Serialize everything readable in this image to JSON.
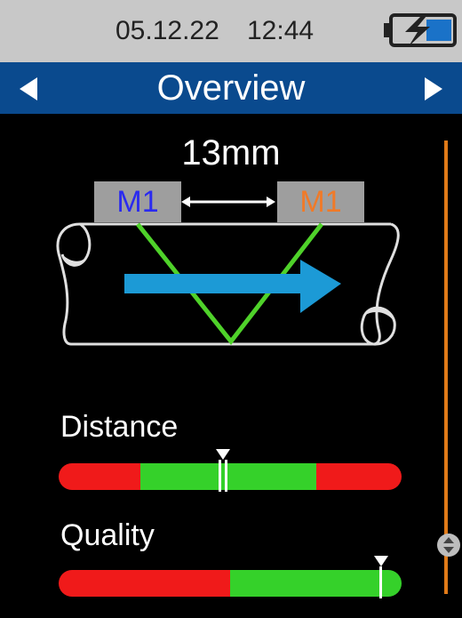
{
  "status": {
    "date": "05.12.22",
    "time": "12:44",
    "battery_icon": "battery-charging-icon"
  },
  "header": {
    "title": "Overview",
    "prev_icon": "left-arrow-icon",
    "next_icon": "right-arrow-icon"
  },
  "setup": {
    "sensor_spacing": "13mm",
    "sensor_left_label": "M1",
    "sensor_right_label": "M1",
    "sensor_left_color": "#2a2af0",
    "sensor_right_color": "#f07a28",
    "beam_color": "#4fd22a",
    "flow_arrow_color": "#1c9ad6"
  },
  "distance": {
    "label": "Distance",
    "value_fraction": 0.48
  },
  "quality": {
    "label": "Quality",
    "value_fraction": 0.94
  },
  "colors": {
    "header": "#0a4a8e",
    "statusbar": "#c8c8c8",
    "bar_good": "#35d12a",
    "bar_bad": "#f01a1a",
    "scroll": "#e07a18"
  }
}
